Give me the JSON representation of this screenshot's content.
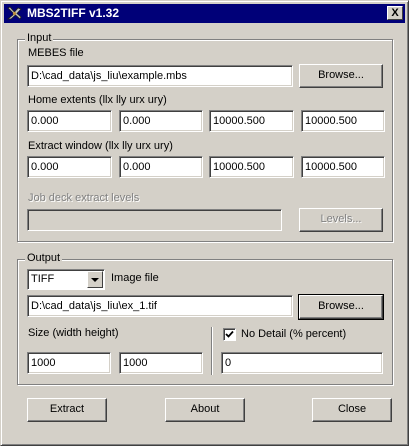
{
  "window": {
    "title": "MBS2TIFF v1.32",
    "close_glyph": "X",
    "icon": "app-icon"
  },
  "input": {
    "legend": "Input",
    "mebes_label": "MEBES file",
    "mebes_value": "D:\\cad_data\\js_liu\\example.mbs",
    "browse_label": "Browse...",
    "home_label": "Home extents (llx lly urx ury)",
    "home_values": [
      "0.000",
      "0.000",
      "10000.500",
      "10000.500"
    ],
    "extract_label": "Extract window (llx lly urx ury)",
    "extract_values": [
      "0.000",
      "0.000",
      "10000.500",
      "10000.500"
    ],
    "jobdeck_label": "Job deck extract levels",
    "jobdeck_value": "",
    "levels_label": "Levels..."
  },
  "output": {
    "legend": "Output",
    "format_selected": "TIFF",
    "image_file_label": "Image file",
    "image_file_value": "D:\\cad_data\\js_liu\\ex_1.tif",
    "browse_label": "Browse...",
    "size_label": "Size (width height)",
    "width": "1000",
    "height": "1000",
    "nodetail_checked": true,
    "nodetail_label": "No Detail (% percent)",
    "nodetail_value": "0"
  },
  "buttons": {
    "extract": "Extract",
    "about": "About",
    "close": "Close"
  }
}
